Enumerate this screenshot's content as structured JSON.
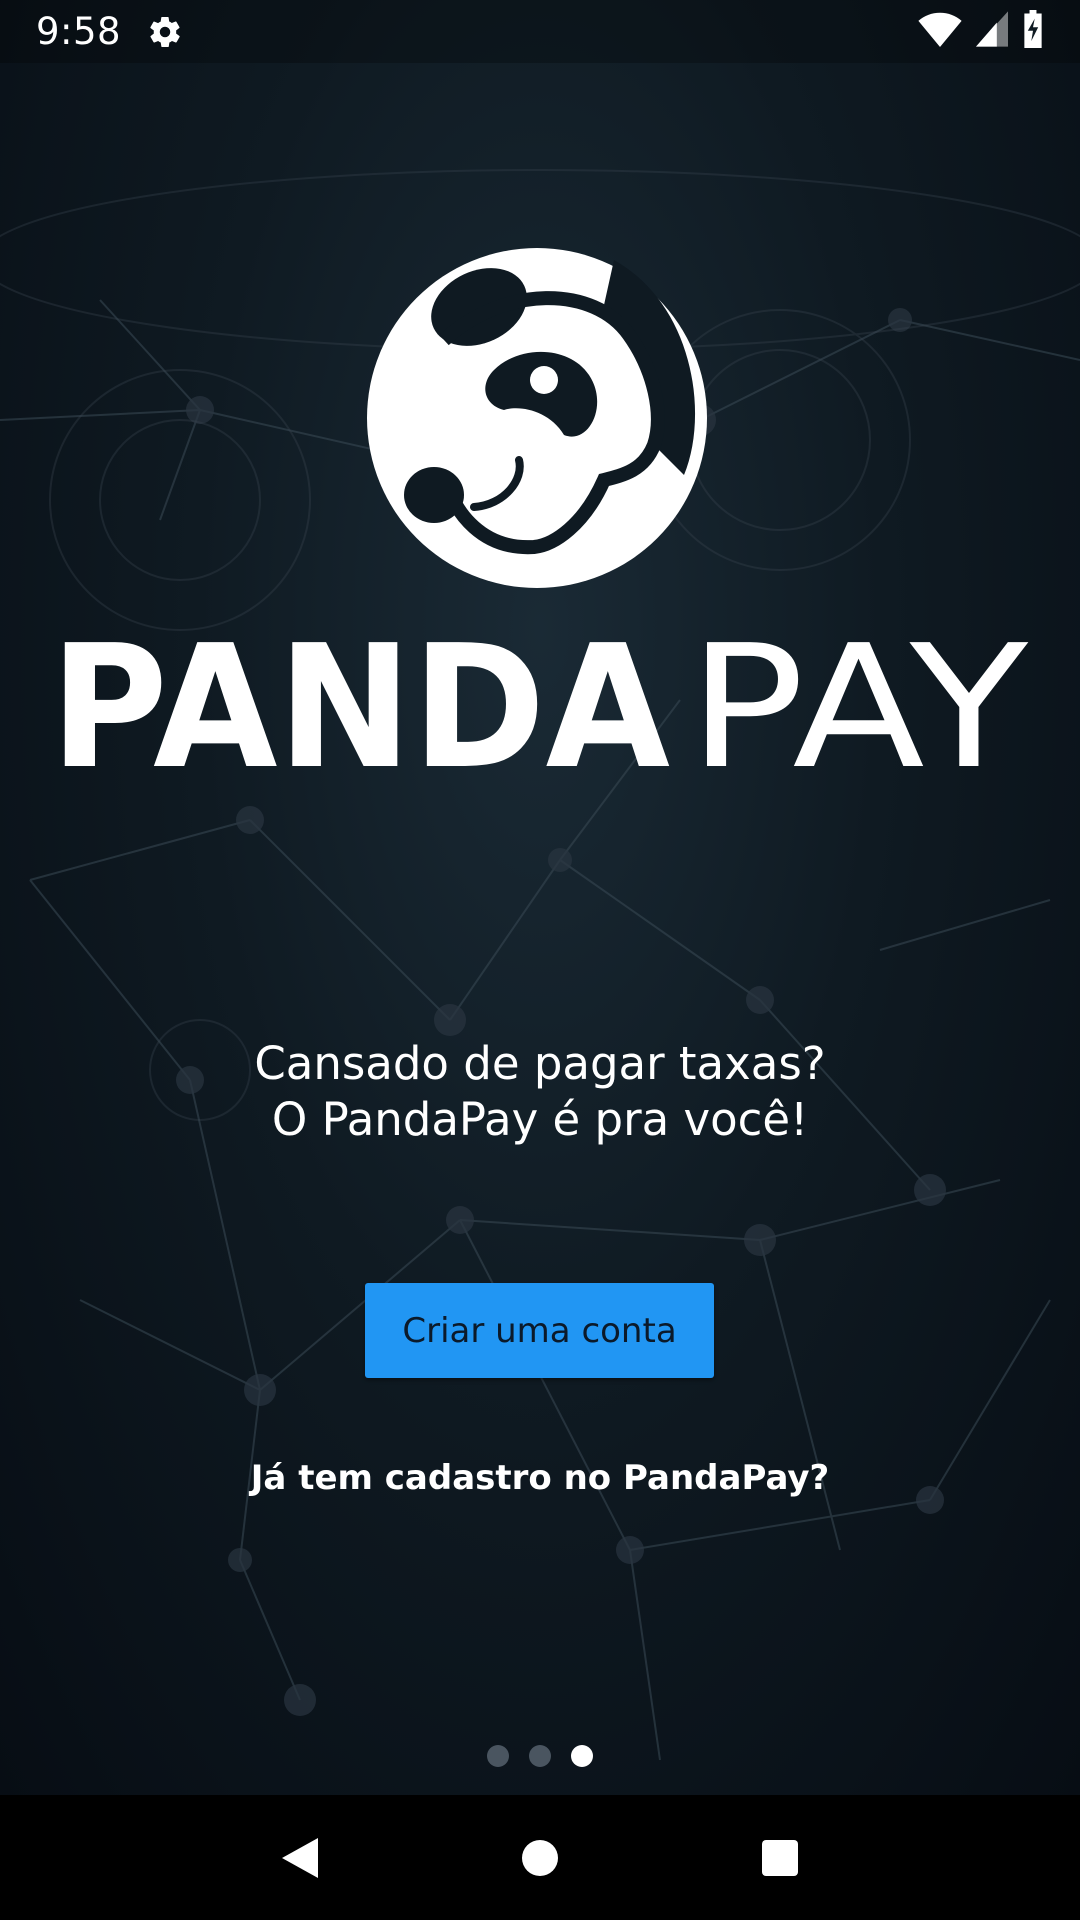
{
  "status_bar": {
    "time": "9:58",
    "icons": [
      "gear-icon",
      "wifi-icon",
      "cell-signal-icon",
      "battery-charging-icon"
    ]
  },
  "brand": {
    "name_bold": "PANDA",
    "name_light": "PAY",
    "logo_icon": "panda-logo-icon"
  },
  "tagline": {
    "line1": "Cansado de pagar taxas?",
    "line2": "O PandaPay é pra você!"
  },
  "actions": {
    "create_account_label": "Criar uma conta",
    "login_link_label": "Já tem cadastro no PandaPay?"
  },
  "pager": {
    "total": 3,
    "active_index": 2
  },
  "nav_bar": {
    "icons": [
      "back-icon",
      "home-icon",
      "recents-icon"
    ]
  },
  "colors": {
    "accent": "#2196f3",
    "text": "#ffffff",
    "background": "#0f1a22"
  }
}
